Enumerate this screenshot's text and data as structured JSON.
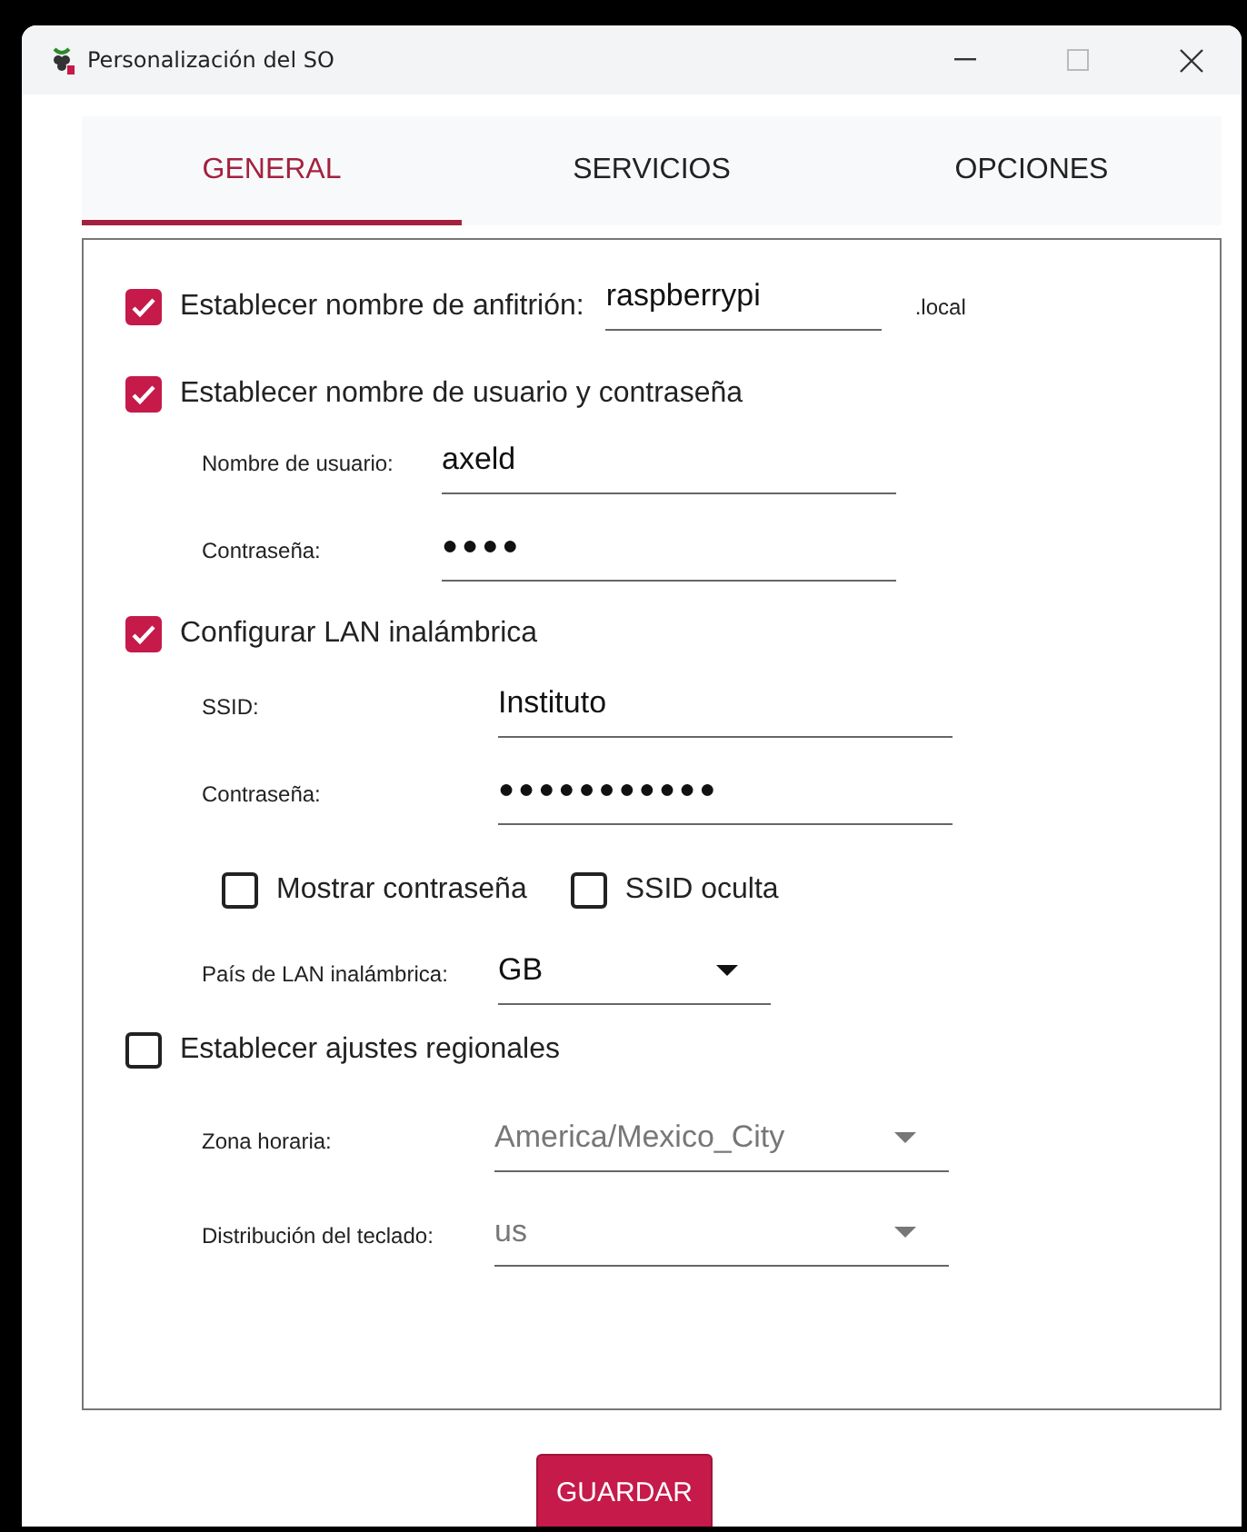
{
  "window": {
    "title": "Personalización del SO"
  },
  "tabs": [
    {
      "label": "GENERAL",
      "selected": true
    },
    {
      "label": "SERVICIOS",
      "selected": false
    },
    {
      "label": "OPCIONES",
      "selected": false
    }
  ],
  "hostname": {
    "label": "Establecer nombre de anfitrión:",
    "checked": true,
    "value": "raspberrypi",
    "suffix": ".local"
  },
  "user": {
    "label": "Establecer nombre de usuario y contraseña",
    "checked": true,
    "fields": [
      {
        "label": "Nombre de usuario:",
        "value": "axeld",
        "kind": "text"
      },
      {
        "label": "Contraseña:",
        "value": "●●●●",
        "kind": "password"
      }
    ]
  },
  "wifi": {
    "label": "Configurar LAN inalámbrica",
    "checked": true,
    "fields": [
      {
        "label": "SSID:",
        "value": "Instituto",
        "kind": "text"
      },
      {
        "label": "Contraseña:",
        "value": "●●●●●●●●●●●",
        "kind": "password"
      }
    ],
    "options": [
      {
        "label": "Mostrar contraseña",
        "checked": false
      },
      {
        "label": "SSID oculta",
        "checked": false
      }
    ],
    "country": {
      "label": "País de LAN inalámbrica:",
      "value": "GB"
    }
  },
  "locale": {
    "label": "Establecer ajustes regionales",
    "checked": false,
    "fields": [
      {
        "label": "Zona horaria:",
        "value": "America/Mexico_City",
        "kind": "select"
      },
      {
        "label": "Distribución del teclado:",
        "value": "us",
        "kind": "select"
      }
    ]
  },
  "buttons": [
    "GUARDAR"
  ]
}
